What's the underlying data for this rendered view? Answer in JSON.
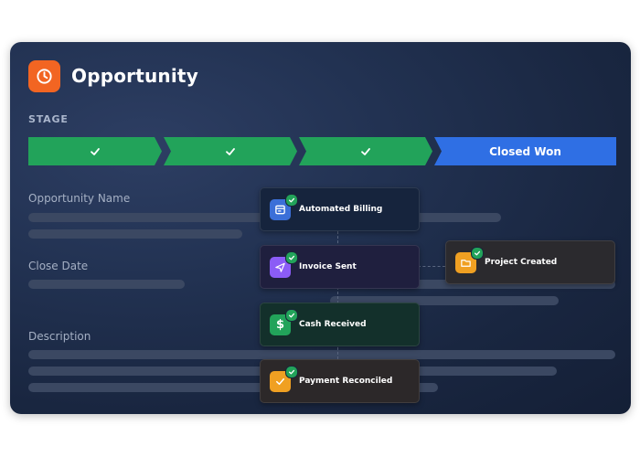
{
  "header": {
    "title": "Opportunity"
  },
  "stage": {
    "label": "STAGE",
    "steps": [
      {
        "status": "complete"
      },
      {
        "status": "complete"
      },
      {
        "status": "complete"
      },
      {
        "status": "current",
        "label": "Closed Won"
      }
    ]
  },
  "fields": [
    {
      "label": "Opportunity Name"
    },
    {
      "label": "Close Date"
    },
    {
      "label": "Description"
    }
  ],
  "workflow": {
    "nodes": [
      {
        "label": "Automated Billing",
        "icon": "billing-icon",
        "icon_color": "#3b6fd8",
        "status": "complete"
      },
      {
        "label": "Invoice Sent",
        "icon": "paper-plane-icon",
        "icon_color": "#8b5cf6",
        "status": "complete"
      },
      {
        "label": "Cash Received",
        "icon": "dollar-icon",
        "icon_color": "#22a35a",
        "status": "complete"
      },
      {
        "label": "Payment Reconciled",
        "icon": "checklist-icon",
        "icon_color": "#f0a022",
        "status": "complete"
      },
      {
        "label": "Project Created",
        "icon": "folder-icon",
        "icon_color": "#f0a022",
        "status": "complete"
      }
    ]
  },
  "colors": {
    "brand": "#f26522",
    "stage_done": "#22a35a",
    "stage_current": "#2f6fe4",
    "card_background": "#1f2d4a"
  }
}
